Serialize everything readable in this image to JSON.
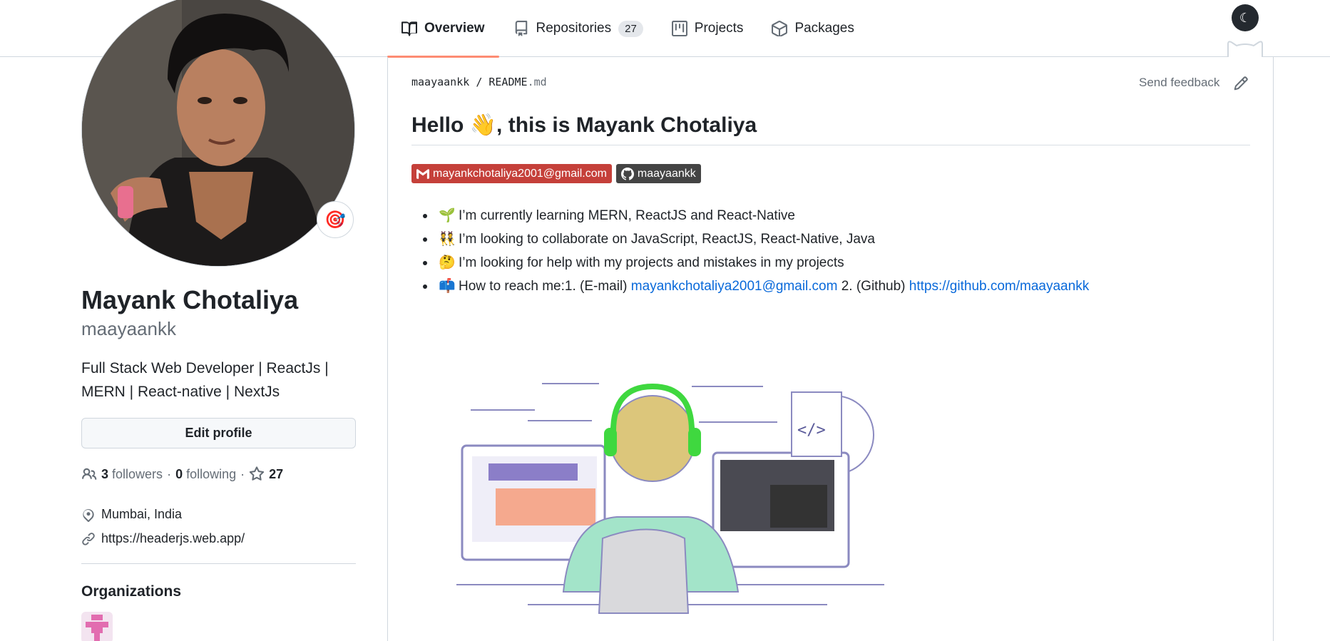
{
  "tabs": [
    {
      "label": "Overview",
      "icon": "book-icon"
    },
    {
      "label": "Repositories",
      "icon": "repo-icon",
      "count": "27"
    },
    {
      "label": "Projects",
      "icon": "project-icon"
    },
    {
      "label": "Packages",
      "icon": "package-icon"
    }
  ],
  "theme_toggle": {
    "icon": "moon-icon"
  },
  "profile": {
    "full_name": "Mayank Chotaliya",
    "login": "maayaankk",
    "bio": "Full Stack Web Developer | ReactJs | MERN | React-native | NextJs",
    "edit_label": "Edit profile",
    "followers_count": "3",
    "followers_label": "followers",
    "separator": "·",
    "following_count": "0",
    "following_label": "following",
    "stars_count": "27",
    "location": "Mumbai, India",
    "website": "https://headerjs.web.app/",
    "organizations_title": "Organizations",
    "status_emoji": "🎯"
  },
  "readme": {
    "owner": "maayaankk",
    "path_sep": "/",
    "file_base": "README",
    "file_ext": ".md",
    "feedback_label": "Send feedback",
    "headline_pre": "Hello ",
    "headline_emoji": "👋",
    "headline_post": ", this is Mayank Chotaliya",
    "badge_email": "mayankchotaliya2001@gmail.com",
    "badge_github": "maayaankk",
    "bullets": [
      {
        "emoji": "🌱",
        "text": "I’m currently learning MERN, ReactJS and React-Native"
      },
      {
        "emoji": "👯",
        "text": "I’m looking to collaborate on JavaScript, ReactJS, React-Native, Java"
      },
      {
        "emoji": "🤔",
        "text": "I’m looking for help with my projects and mistakes in my projects"
      },
      {
        "emoji": "📫",
        "text": "How to reach me:1. (E-mail) ",
        "link1": "mayankchotaliya2001@gmail.com",
        "mid": " 2. (Github) ",
        "link2": "https://github.com/maayaankk"
      }
    ]
  },
  "colors": {
    "accent_tab": "#fd8c73",
    "link": "#0969da",
    "gmail_badge": "#c5403a",
    "github_badge": "#444444"
  }
}
